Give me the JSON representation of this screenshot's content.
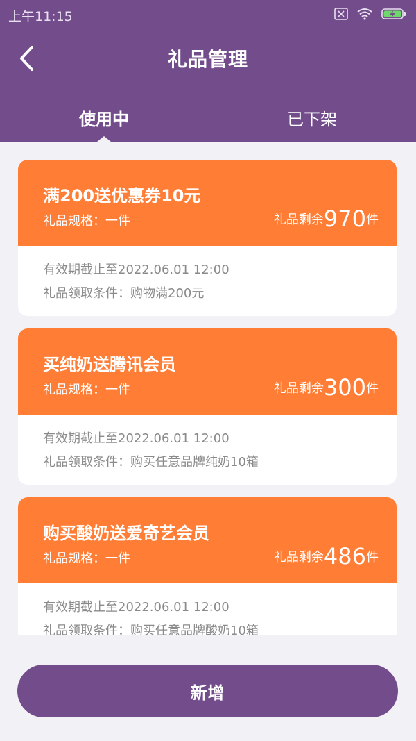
{
  "status_bar": {
    "time": "上午11:15"
  },
  "nav": {
    "title": "礼品管理"
  },
  "tabs": [
    {
      "label": "使用中",
      "active": true
    },
    {
      "label": "已下架",
      "active": false
    }
  ],
  "gifts": [
    {
      "title": "满200送优惠券10元",
      "spec": "礼品规格：一件",
      "remain_prefix": "礼品剩余",
      "remain_count": "970",
      "remain_unit": "件",
      "validity": "有效期截止至2022.06.01 12:00",
      "condition": "礼品领取条件：购物满200元"
    },
    {
      "title": "买纯奶送腾讯会员",
      "spec": "礼品规格：一件",
      "remain_prefix": "礼品剩余",
      "remain_count": "300",
      "remain_unit": "件",
      "validity": "有效期截止至2022.06.01 12:00",
      "condition": "礼品领取条件：购买任意品牌纯奶10箱"
    },
    {
      "title": "购买酸奶送爱奇艺会员",
      "spec": "礼品规格：一件",
      "remain_prefix": "礼品剩余",
      "remain_count": "486",
      "remain_unit": "件",
      "validity": "有效期截止至2022.06.01 12:00",
      "condition": "礼品领取条件：购买任意品牌酸奶10箱"
    }
  ],
  "add_button": {
    "label": "新增"
  },
  "colors": {
    "header": "#734c8c",
    "card_accent": "#ff7d34",
    "background": "#f2f2f6"
  }
}
